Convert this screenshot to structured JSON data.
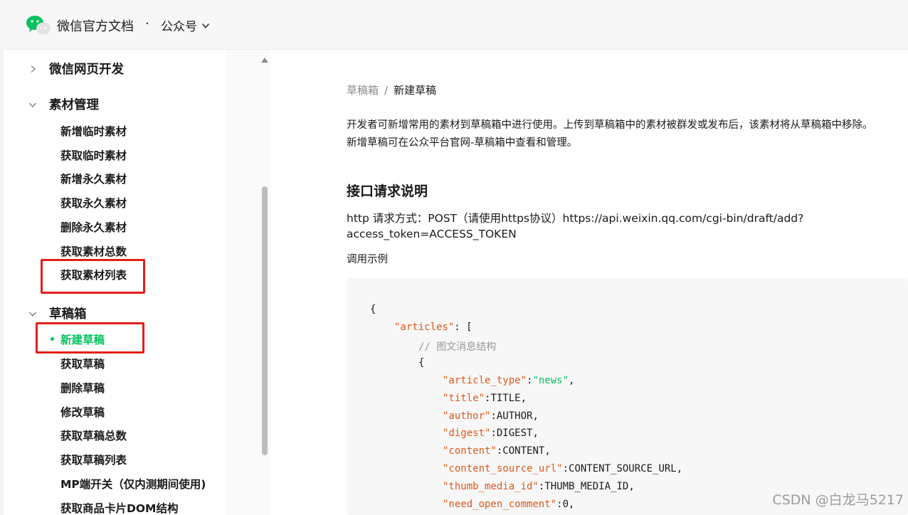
{
  "header": {
    "site_title": "微信官方文档",
    "dot": "·",
    "section": "公众号",
    "logo_icon": "wechat-logo-icon",
    "section_icon": "chevron-down-icon",
    "brand_color": "#07c160"
  },
  "sidebar": {
    "groups": [
      {
        "label": "微信网页开发",
        "state": "collapsed"
      },
      {
        "label": "素材管理",
        "state": "expanded"
      },
      {
        "label": "草稿箱",
        "state": "expanded"
      }
    ],
    "material_items": [
      "新增临时素材",
      "获取临时素材",
      "新增永久素材",
      "获取永久素材",
      "删除永久素材",
      "获取素材总数",
      "获取素材列表"
    ],
    "draft_items": [
      "新建草稿",
      "获取草稿",
      "删除草稿",
      "修改草稿",
      "获取草稿总数",
      "获取草稿列表",
      "MP端开关（仅内测期间使用)",
      "获取商品卡片DOM结构"
    ],
    "active_item": "新建草稿",
    "highlight_color": "#e0201a"
  },
  "content": {
    "breadcrumb": {
      "parent": "草稿箱",
      "separator": "/",
      "current": "新建草稿"
    },
    "intro": [
      "开发者可新增常用的素材到草稿箱中进行使用。上传到草稿箱中的素材被群发或发布后，该素材将从草稿箱中移除。",
      "新增草稿可在公众平台官网-草稿箱中查看和管理。"
    ],
    "section_title": "接口请求说明",
    "http_lines": [
      "http 请求方式：POST（请使用https协议）https://api.weixin.qq.com/cgi-bin/draft/add?",
      "access_token=ACCESS_TOKEN"
    ],
    "example_label": "调用示例",
    "code": {
      "open_brace": "{",
      "articles_key": "\"articles\"",
      "articles_rest": ": [",
      "comment": "// 图文消息结构",
      "item_brace": "{",
      "fields": [
        {
          "key": "\"article_type\"",
          "sep": ":",
          "value": "\"news\"",
          "tail": ",",
          "string": true
        },
        {
          "key": "\"title\"",
          "sep": ":",
          "value": "TITLE",
          "tail": ",",
          "string": false
        },
        {
          "key": "\"author\"",
          "sep": ":",
          "value": "AUTHOR",
          "tail": ",",
          "string": false
        },
        {
          "key": "\"digest\"",
          "sep": ":",
          "value": "DIGEST",
          "tail": ",",
          "string": false
        },
        {
          "key": "\"content\"",
          "sep": ":",
          "value": "CONTENT",
          "tail": ",",
          "string": false
        },
        {
          "key": "\"content_source_url\"",
          "sep": ":",
          "value": "CONTENT_SOURCE_URL",
          "tail": ",",
          "string": false
        },
        {
          "key": "\"thumb_media_id\"",
          "sep": ":",
          "value": "THUMB_MEDIA_ID",
          "tail": ",",
          "string": false
        },
        {
          "key": "\"need_open_comment\"",
          "sep": ":",
          "value": "0",
          "tail": ",",
          "string": false
        }
      ]
    }
  },
  "watermark": "CSDN @白龙马5217"
}
